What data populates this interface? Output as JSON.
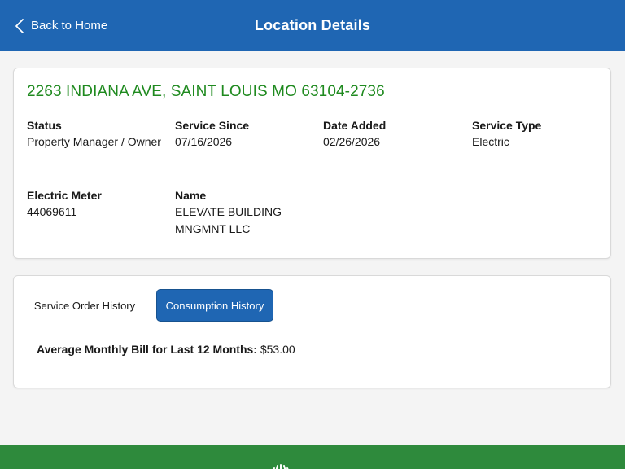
{
  "header": {
    "back_label": "Back to Home",
    "title": "Location Details"
  },
  "location": {
    "address": "2263 INDIANA AVE, SAINT LOUIS MO 63104-2736",
    "fields": {
      "status": {
        "label": "Status",
        "value": "Property Manager / Owner"
      },
      "service_since": {
        "label": "Service Since",
        "value": "07/16/2026"
      },
      "date_added": {
        "label": "Date Added",
        "value": "02/26/2026"
      },
      "service_type": {
        "label": "Service Type",
        "value": "Electric"
      },
      "electric_meter": {
        "label": "Electric Meter",
        "value": "44069611"
      },
      "name": {
        "label": "Name",
        "value": "ELEVATE BUILDING MNGMNT LLC"
      }
    }
  },
  "history": {
    "tabs": {
      "service_order": "Service Order History",
      "consumption": "Consumption History"
    },
    "active_tab": "consumption",
    "avg_label": "Average Monthly Bill for Last 12 Months:",
    "avg_value": "$53.00"
  },
  "colors": {
    "header": "#1f66b3",
    "address": "#1f8a1f",
    "footer": "#2e8a3c",
    "active_tab": "#1f66b3"
  },
  "icons": {
    "back": "chevron-left-icon",
    "footer": "brand-logo-icon"
  }
}
